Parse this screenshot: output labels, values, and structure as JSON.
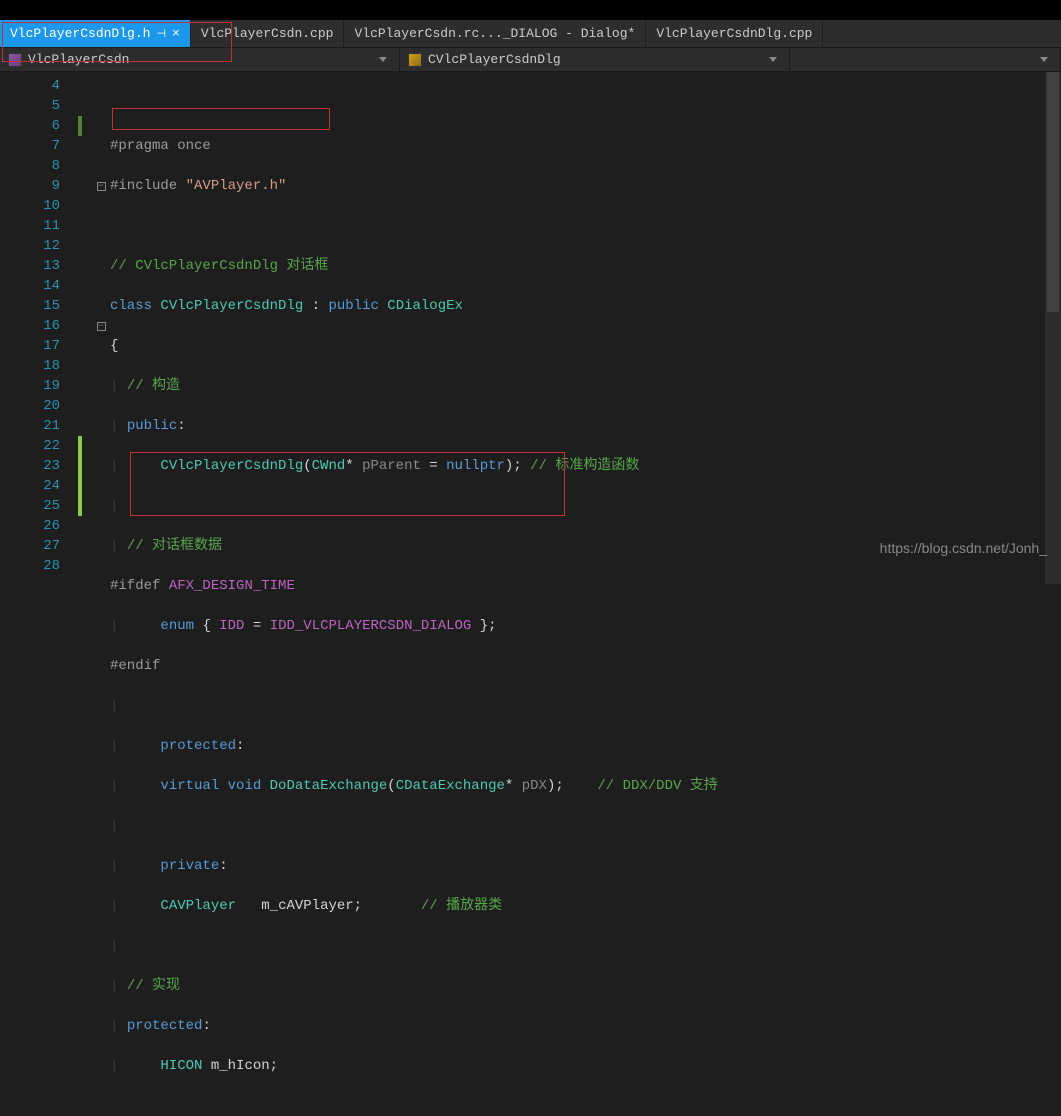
{
  "tabs": [
    {
      "label": "VlcPlayerCsdnDlg.h",
      "active": true,
      "pin": "⊣",
      "close": "×"
    },
    {
      "label": "VlcPlayerCsdn.cpp",
      "active": false
    },
    {
      "label": "VlcPlayerCsdn.rc..._DIALOG - Dialog*",
      "active": false
    },
    {
      "label": "VlcPlayerCsdnDlg.cpp",
      "active": false
    }
  ],
  "nav": {
    "left": "VlcPlayerCsdn",
    "right": "CVlcPlayerCsdnDlg"
  },
  "lines": {
    "4": "",
    "5": "#pragma once",
    "6": "#include \"AVPlayer.h\"",
    "7": "",
    "8": "// CVlcPlayerCsdnDlg 对话框",
    "9": "class CVlcPlayerCsdnDlg : public CDialogEx",
    "10": "{",
    "11": "// 构造",
    "12": "public:",
    "13": "    CVlcPlayerCsdnDlg(CWnd* pParent = nullptr); // 标准构造函数",
    "14": "",
    "15": "// 对话框数据",
    "16": "#ifdef AFX_DESIGN_TIME",
    "17": "    enum { IDD = IDD_VLCPLAYERCSDN_DIALOG };",
    "18": "#endif",
    "19": "",
    "20": "    protected:",
    "21": "    virtual void DoDataExchange(CDataExchange* pDX);    // DDX/DDV 支持",
    "22": "",
    "23": "    private:",
    "24": "    CAVPlayer   m_cAVPlayer;       // 播放器类",
    "25": "    ",
    "26": "// 实现",
    "27": "protected:",
    "28": "    HICON m_hIcon;"
  },
  "watermark": "https://blog.csdn.net/Jonh_"
}
